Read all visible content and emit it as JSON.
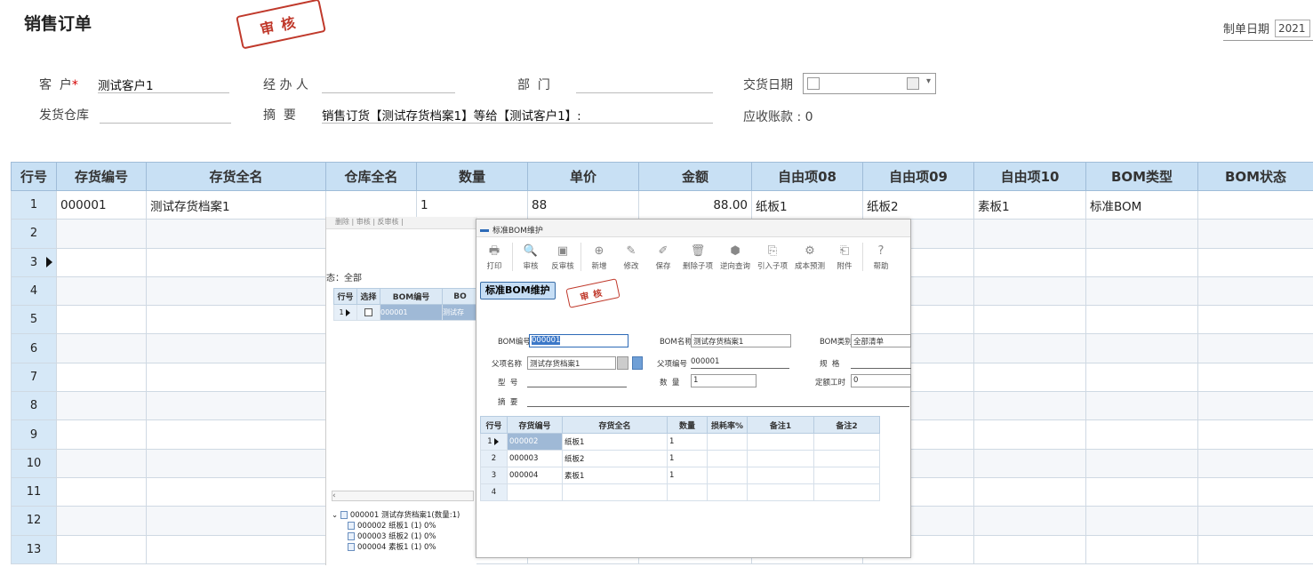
{
  "header": {
    "title": "销售订单",
    "stamp": "审核",
    "date_label": "制单日期",
    "date_value": "2021"
  },
  "form": {
    "customer_label": "客  户",
    "customer_star": "*",
    "customer_value": "测试客户1",
    "handler_label": "经 办 人",
    "handler_value": "",
    "dept_label": "部  门",
    "dept_value": "",
    "delivery_date_label": "交货日期",
    "warehouse_label": "发货仓库",
    "warehouse_value": "",
    "summary_label": "摘  要",
    "summary_value": "销售订货【测试存货档案1】等给【测试客户1】:",
    "receivable_label": "应收账款",
    "receivable_value": ": 0"
  },
  "grid": {
    "columns": [
      "行号",
      "存货编号",
      "存货全名",
      "仓库全名",
      "数量",
      "单价",
      "金额",
      "自由项08",
      "自由项09",
      "自由项10",
      "BOM类型",
      "BOM状态"
    ],
    "rows": [
      {
        "no": "1",
        "code": "000001",
        "name": "测试存货档案1",
        "wh": "",
        "qty": "1",
        "price": "88",
        "amount": "88.00",
        "f08": "纸板1",
        "f09": "纸板2",
        "f10": "素板1",
        "bomtype": "标准BOM",
        "bomstate": ""
      },
      {
        "no": "2"
      },
      {
        "no": "3"
      },
      {
        "no": "4"
      },
      {
        "no": "5"
      },
      {
        "no": "6"
      },
      {
        "no": "7"
      },
      {
        "no": "8"
      },
      {
        "no": "9"
      },
      {
        "no": "10"
      },
      {
        "no": "11"
      },
      {
        "no": "12"
      },
      {
        "no": "13"
      }
    ]
  },
  "bg_dialog": {
    "top_strip": "删除 | 审核 | 反审核 |",
    "status": "态：全部",
    "columns": [
      "行号",
      "选择",
      "BOM编号",
      "BO"
    ],
    "row": {
      "no": "1",
      "code": "000001",
      "name": "测试存"
    },
    "tree": [
      "000001 测试存货档案1(数量:1)",
      "000002 纸板1 (1) 0%",
      "000003 纸板2 (1) 0%",
      "000004 素板1 (1) 0%"
    ]
  },
  "bom": {
    "window_title": "标准BOM维护",
    "toolbar": [
      {
        "icon": "printer-icon",
        "glyph": "🖶",
        "label": "打印"
      },
      {
        "icon": "search-icon",
        "glyph": "🔍",
        "label": "审核"
      },
      {
        "icon": "unaudit-icon",
        "glyph": "▣",
        "label": "反审核"
      },
      {
        "icon": "plus-icon",
        "glyph": "⊕",
        "label": "新增"
      },
      {
        "icon": "edit-icon",
        "glyph": "✎",
        "label": "修改"
      },
      {
        "icon": "save-icon",
        "glyph": "✐",
        "label": "保存"
      },
      {
        "icon": "trash-icon",
        "glyph": "🗑",
        "label": "删除子项"
      },
      {
        "icon": "cube-icon",
        "glyph": "⬢",
        "label": "逆向查询"
      },
      {
        "icon": "import-icon",
        "glyph": "⎘",
        "label": "引入子项"
      },
      {
        "icon": "gear-icon",
        "glyph": "⚙",
        "label": "成本预测"
      },
      {
        "icon": "attachment-icon",
        "glyph": "⎗",
        "label": "附件"
      },
      {
        "icon": "help-icon",
        "glyph": "?",
        "label": "帮助"
      }
    ],
    "panel_title": "标准BOM维护",
    "stamp": "审核",
    "fields": {
      "bom_code_label": "BOM编号",
      "bom_code_value": "000001",
      "bom_name_label": "BOM名称",
      "bom_name_value": "测试存货档案1",
      "bom_type_label": "BOM类别",
      "bom_type_value": "全部清单",
      "parent_name_label": "父项名称",
      "parent_name_value": "测试存货档案1",
      "parent_code_label": "父项编号",
      "parent_code_value": "000001",
      "spec_label": "规  格",
      "model_label": "型  号",
      "qty_label": "数  量",
      "qty_value": "1",
      "worktime_label": "定额工时",
      "worktime_value": "0",
      "summary_label": "摘  要"
    },
    "columns": [
      "行号",
      "存货编号",
      "存货全名",
      "数量",
      "损耗率%",
      "备注1",
      "备注2"
    ],
    "rows": [
      {
        "no": "1",
        "code": "000002",
        "name": "纸板1",
        "qty": "1"
      },
      {
        "no": "2",
        "code": "000003",
        "name": "纸板2",
        "qty": "1"
      },
      {
        "no": "3",
        "code": "000004",
        "name": "素板1",
        "qty": "1"
      },
      {
        "no": "4",
        "code": "",
        "name": "",
        "qty": ""
      }
    ]
  }
}
